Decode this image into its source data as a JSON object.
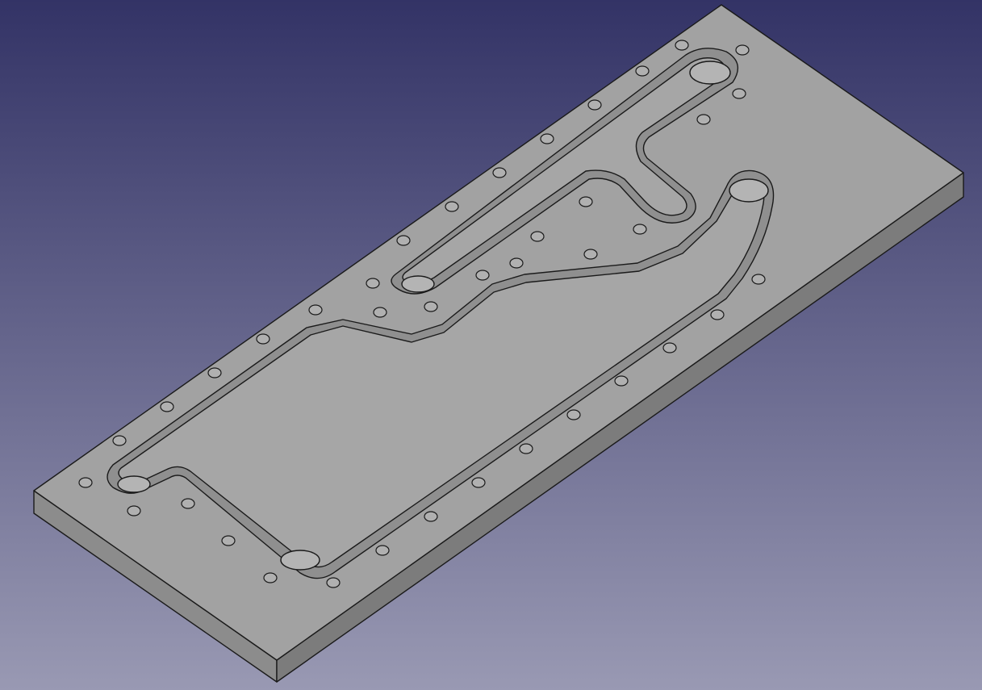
{
  "viewport": {
    "background_top": "#333366",
    "background_bottom": "#9999b3"
  },
  "model": {
    "face_color": "#a2a2a2",
    "side_color": "#7c7c7c",
    "end_color": "#8c8c8c",
    "pocket_color": "#a6a6a6",
    "hole_color": "#b4b4b4",
    "edge_color": "#1a1a1a"
  }
}
